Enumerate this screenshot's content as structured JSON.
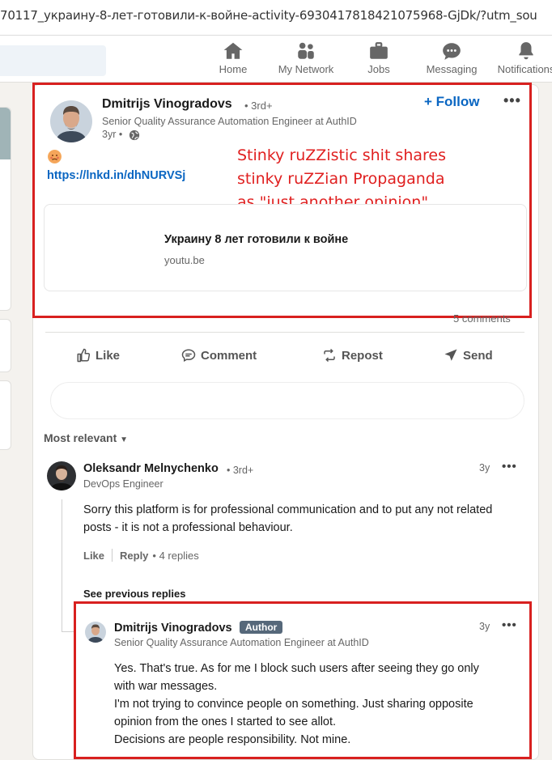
{
  "browser": {
    "url": "70117_украину-8-лет-готовили-к-войне-activity-6930417818421075968-GjDk/?utm_sou"
  },
  "nav": {
    "items": [
      {
        "label": "Home",
        "icon": "home-icon"
      },
      {
        "label": "My Network",
        "icon": "network-icon"
      },
      {
        "label": "Jobs",
        "icon": "briefcase-icon"
      },
      {
        "label": "Messaging",
        "icon": "messaging-icon"
      },
      {
        "label": "Notifications",
        "icon": "bell-icon"
      }
    ]
  },
  "post": {
    "author": {
      "name": "Dmitrijs Vinogradovs",
      "degree": "• 3rd+",
      "headline": "Senior Quality Assurance Automation Engineer at AuthID",
      "time": "3yr •"
    },
    "follow_label": "+ Follow",
    "link_text": "https://lnkd.in/dhNURVSj",
    "link_preview": {
      "title": "Украину 8 лет готовили к войне",
      "source": "youtu.be"
    },
    "comments_count": "5 comments"
  },
  "annotation": {
    "lines": [
      "Stinky ruZZistic shit shares",
      "stinky ruZZian Propaganda",
      "as \"just another opinion\""
    ],
    "color": "#d8201f"
  },
  "actions": {
    "like": "Like",
    "comment": "Comment",
    "repost": "Repost",
    "send": "Send"
  },
  "sort_label": "Most relevant",
  "comments": [
    {
      "name": "Oleksandr Melnychenko",
      "degree": "• 3rd+",
      "headline": "DevOps Engineer",
      "time": "3y",
      "body": "Sorry this platform is for professional communication and to put any not related posts - it is not a professional behaviour.",
      "like": "Like",
      "reply": "Reply",
      "replies": "• 4 replies"
    }
  ],
  "see_previous": "See previous replies",
  "reply": {
    "name": "Dmitrijs Vinogradovs",
    "badge": "Author",
    "headline": "Senior Quality Assurance Automation Engineer at AuthID",
    "time": "3y",
    "lines": [
      "Yes. That's true. As for me I block such users after seeing they go only",
      "with war messages.",
      "I'm not trying to convince people on something. Just sharing opposite",
      "opinion from the ones I started to see allot.",
      "Decisions are people responsibility. Not mine."
    ]
  },
  "colors": {
    "accent": "#0a66c2",
    "annotation_red": "#d8201f"
  }
}
